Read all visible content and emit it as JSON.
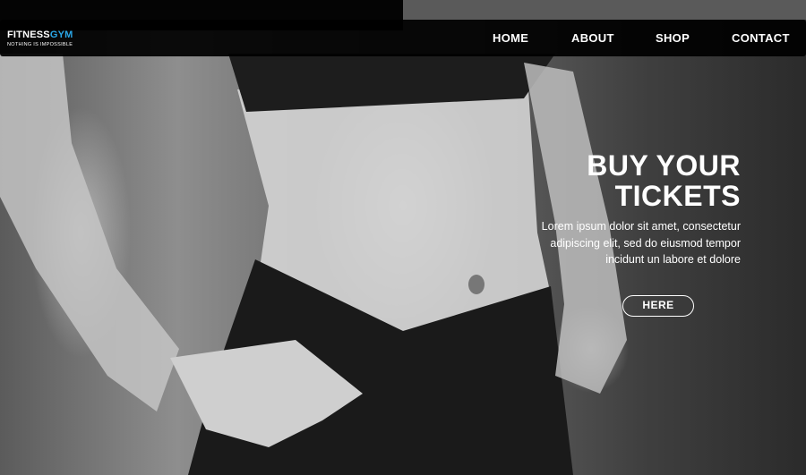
{
  "brand": {
    "name_part1": "FITNESS",
    "name_part2": "GYM",
    "tagline": "NOTHING IS IMPOSSIBLE",
    "accent_color": "#2aa7e8"
  },
  "nav": {
    "items": [
      {
        "label": "HOME"
      },
      {
        "label": "ABOUT"
      },
      {
        "label": "SHOP"
      },
      {
        "label": "CONTACT"
      }
    ]
  },
  "hero": {
    "headline_line1": "BUY YOUR",
    "headline_line2": "TICKETS",
    "body": "Lorem ipsum dolor sit amet, consectetur adipiscing elit, sed do eiusmod tempor incidunt un labore et dolore",
    "cta_label": "HERE"
  }
}
